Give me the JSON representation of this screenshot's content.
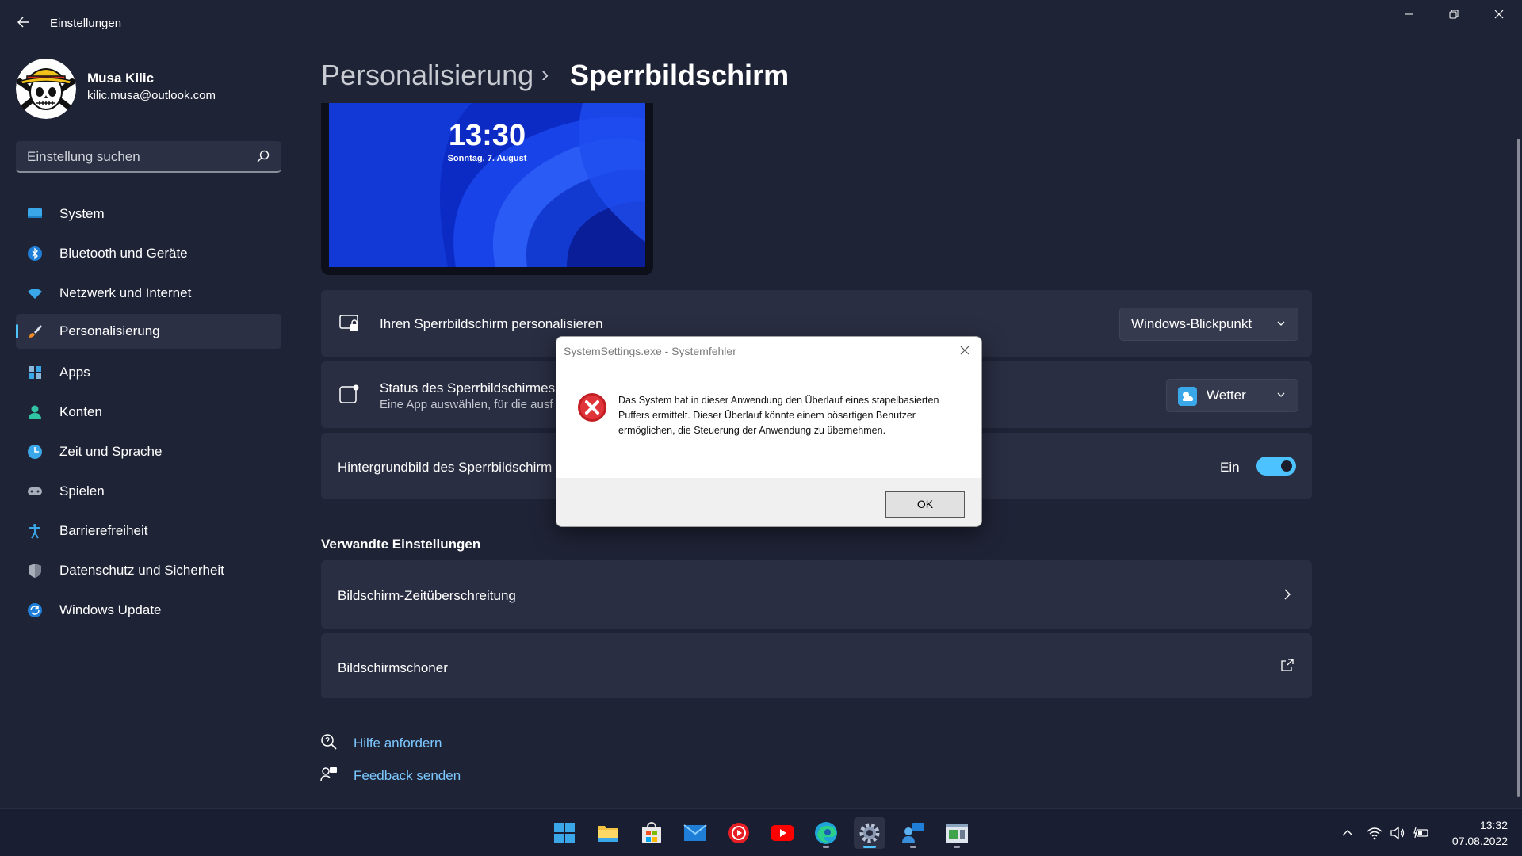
{
  "window": {
    "title": "Einstellungen",
    "minimize_icon": "minimize-icon",
    "maximize_icon": "restore-icon",
    "close_icon": "close-icon"
  },
  "profile": {
    "name": "Musa Kilic",
    "email": "kilic.musa@outlook.com"
  },
  "search": {
    "placeholder": "Einstellung suchen"
  },
  "sidebar": {
    "items": [
      {
        "label": "System",
        "icon": "system-icon"
      },
      {
        "label": "Bluetooth und Geräte",
        "icon": "bluetooth-icon"
      },
      {
        "label": "Netzwerk und Internet",
        "icon": "wifi-icon"
      },
      {
        "label": "Personalisierung",
        "icon": "brush-icon",
        "active": true
      },
      {
        "label": "Apps",
        "icon": "apps-icon"
      },
      {
        "label": "Konten",
        "icon": "account-icon"
      },
      {
        "label": "Zeit und Sprache",
        "icon": "time-language-icon"
      },
      {
        "label": "Spielen",
        "icon": "gamepad-icon"
      },
      {
        "label": "Barrierefreiheit",
        "icon": "accessibility-icon"
      },
      {
        "label": "Datenschutz und Sicherheit",
        "icon": "shield-icon"
      },
      {
        "label": "Windows Update",
        "icon": "update-icon"
      }
    ]
  },
  "breadcrumb": {
    "parent": "Personalisierung",
    "separator": "›",
    "current": "Sperrbildschirm"
  },
  "preview": {
    "time": "13:30",
    "date": "Sonntag, 7. August"
  },
  "cards": {
    "personalize": {
      "title": "Ihren Sperrbildschirm personalisieren",
      "value": "Windows-Blickpunkt"
    },
    "status": {
      "title": "Status des Sperrbildschirmes",
      "subtitle": "Eine App auswählen, für die ausf",
      "value": "Wetter"
    },
    "background": {
      "title": "Hintergrundbild des Sperrbildschirm",
      "toggle_label": "Ein",
      "toggle_on": true
    }
  },
  "related": {
    "heading": "Verwandte Einstellungen",
    "items": [
      {
        "label": "Bildschirm-Zeitüberschreitung",
        "icon": "chevron-right-icon"
      },
      {
        "label": "Bildschirmschoner",
        "icon": "external-link-icon"
      }
    ]
  },
  "help": {
    "get_help": "Hilfe anfordern",
    "feedback": "Feedback senden"
  },
  "dialog": {
    "title": "SystemSettings.exe - Systemfehler",
    "message": "Das System hat in dieser Anwendung den Überlauf eines stapelbasierten Puffers ermittelt. Dieser Überlauf könnte einem bösartigen Benutzer ermöglichen, die Steuerung der Anwendung zu übernehmen.",
    "ok_label": "OK"
  },
  "taskbar": {
    "apps": [
      "start-icon",
      "file-explorer-icon",
      "store-icon",
      "mail-icon",
      "music-player-icon",
      "youtube-icon",
      "edge-icon",
      "settings-icon",
      "remote-support-icon",
      "vm-icon"
    ],
    "time": "13:32",
    "date": "07.08.2022"
  },
  "colors": {
    "accent": "#4cc2ff",
    "background": "#1f2336",
    "card": "#2a2e42",
    "error": "#d9262b"
  }
}
